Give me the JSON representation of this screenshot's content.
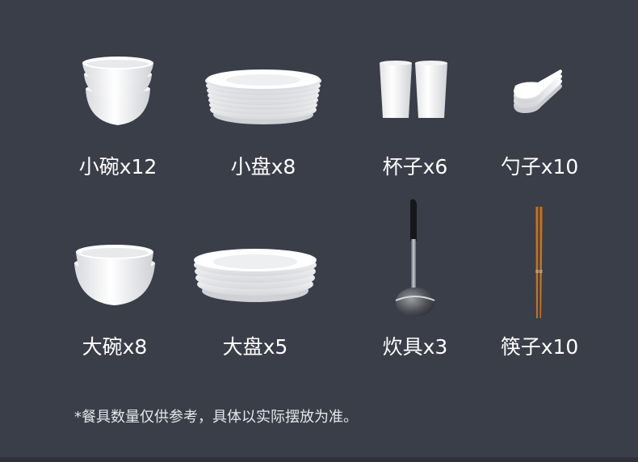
{
  "items": [
    {
      "label": "小碗x12",
      "icon": "small-bowl-stack-icon"
    },
    {
      "label": "小盘x8",
      "icon": "small-plate-stack-icon"
    },
    {
      "label": "杯子x6",
      "icon": "cups-icon"
    },
    {
      "label": "勺子x10",
      "icon": "spoons-icon"
    },
    {
      "label": "大碗x8",
      "icon": "large-bowl-stack-icon"
    },
    {
      "label": "大盘x5",
      "icon": "large-plate-stack-icon"
    },
    {
      "label": "炊具x3",
      "icon": "ladle-icon"
    },
    {
      "label": "筷子x10",
      "icon": "chopsticks-icon"
    }
  ],
  "note": "*餐具数量仅供参考，具体以实际摆放为准。",
  "colors": {
    "background": "#3a3e48",
    "text": "#ffffff",
    "porcelain": "#ffffff",
    "chopsticks": "#c7721f"
  }
}
